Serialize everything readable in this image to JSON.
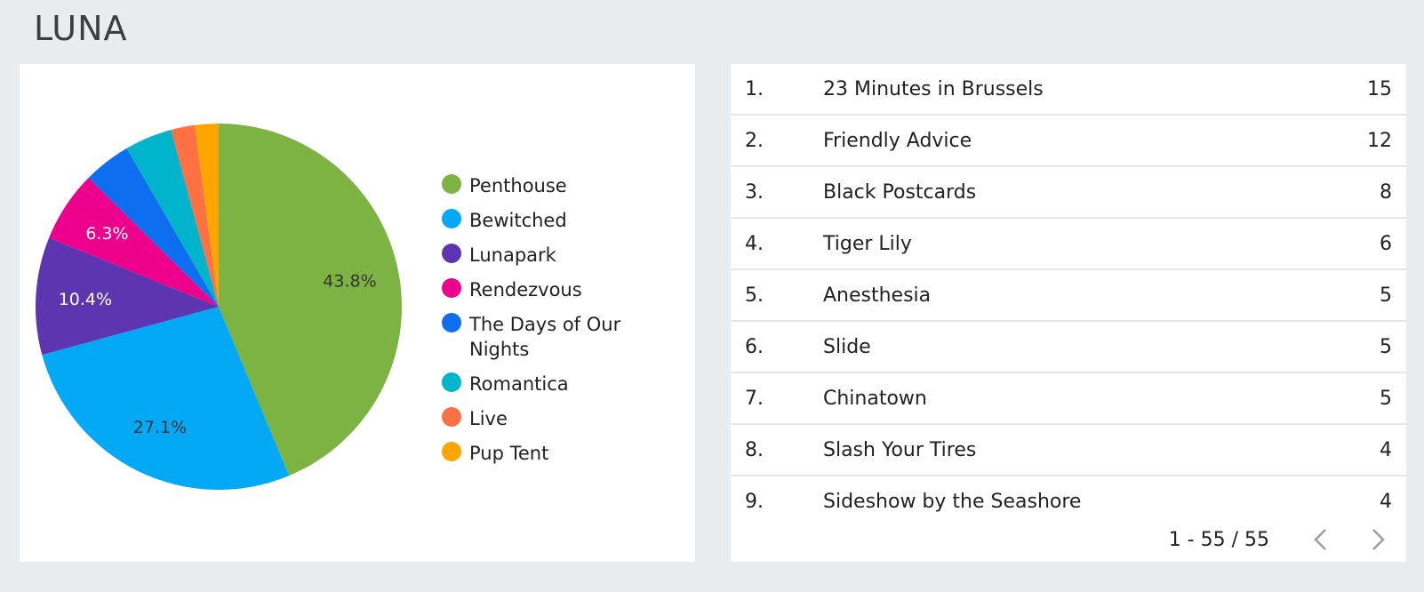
{
  "page": {
    "title": "LUNA"
  },
  "chart_data": {
    "type": "pie",
    "categories": [
      "Penthouse",
      "Bewitched",
      "Lunapark",
      "Rendezvous",
      "The Days of Our Nights",
      "Romantica",
      "Live",
      "Pup Tent"
    ],
    "values": [
      43.8,
      27.1,
      10.4,
      6.3,
      4.2,
      4.2,
      2.1,
      2.1
    ],
    "labels": [
      "43.8%",
      "27.1%",
      "10.4%",
      "6.3%",
      "",
      "",
      "",
      ""
    ],
    "colors": [
      "#7cb342",
      "#03a9f4",
      "#5e35b1",
      "#ec008c",
      "#0d6eef",
      "#00b4cc",
      "#ff7043",
      "#ffa500"
    ],
    "legend_position": "right"
  },
  "legend": {
    "items": [
      {
        "label": "Penthouse",
        "color": "#7cb342"
      },
      {
        "label": "Bewitched",
        "color": "#03a9f4"
      },
      {
        "label": "Lunapark",
        "color": "#5e35b1"
      },
      {
        "label": "Rendezvous",
        "color": "#ec008c"
      },
      {
        "label": "The Days of Our Nights",
        "color": "#0d6eef"
      },
      {
        "label": "Romantica",
        "color": "#00b4cc"
      },
      {
        "label": "Live",
        "color": "#ff7043"
      },
      {
        "label": "Pup Tent",
        "color": "#ffa500"
      }
    ]
  },
  "table": {
    "rows": [
      {
        "idx": "1.",
        "name": "23 Minutes in Brussels",
        "count": "15"
      },
      {
        "idx": "2.",
        "name": "Friendly Advice",
        "count": "12"
      },
      {
        "idx": "3.",
        "name": "Black Postcards",
        "count": "8"
      },
      {
        "idx": "4.",
        "name": "Tiger Lily",
        "count": "6"
      },
      {
        "idx": "5.",
        "name": "Anesthesia",
        "count": "5"
      },
      {
        "idx": "6.",
        "name": "Slide",
        "count": "5"
      },
      {
        "idx": "7.",
        "name": "Chinatown",
        "count": "5"
      },
      {
        "idx": "8.",
        "name": "Slash Your Tires",
        "count": "4"
      },
      {
        "idx": "9.",
        "name": "Sideshow by the Seashore",
        "count": "4"
      }
    ]
  },
  "pager": {
    "range_text": "1 - 55 / 55",
    "prev_icon": "chevron-left-icon",
    "next_icon": "chevron-right-icon"
  }
}
